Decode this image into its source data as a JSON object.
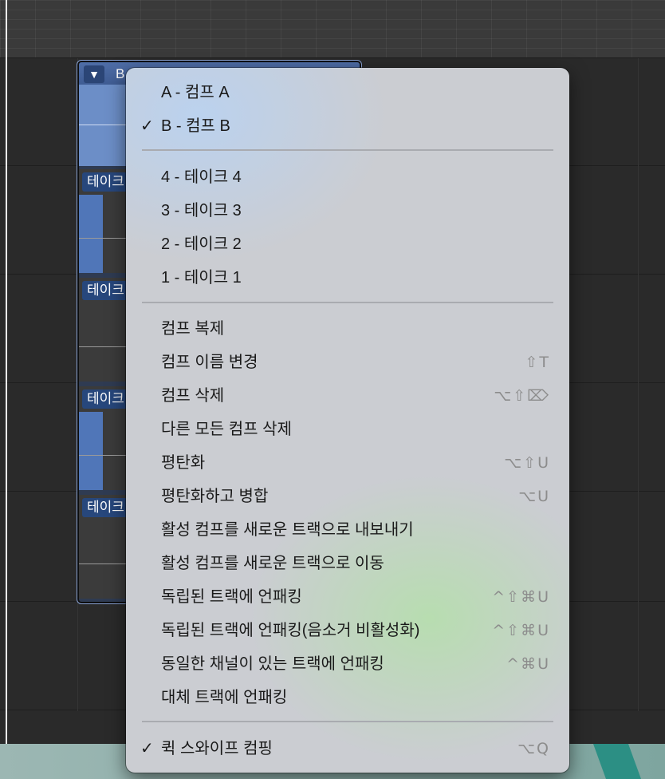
{
  "background": {
    "take_folder": {
      "disclosure_icon": "▼",
      "name": "B",
      "take_labels": [
        "테이크",
        "테이크",
        "테이크",
        "테이크"
      ]
    }
  },
  "menu": {
    "comps": [
      {
        "label": "A - 컴프 A",
        "checked": false
      },
      {
        "label": "B - 컴프 B",
        "checked": true
      }
    ],
    "takes": [
      {
        "label": "4 - 테이크 4"
      },
      {
        "label": "3 - 테이크 3"
      },
      {
        "label": "2 - 테이크 2"
      },
      {
        "label": "1 - 테이크 1"
      }
    ],
    "actions": [
      {
        "label": "컴프 복제",
        "shortcut": ""
      },
      {
        "label": "컴프 이름 변경",
        "shortcut": "⇧T"
      },
      {
        "label": "컴프 삭제",
        "shortcut": "⌥⇧⌦"
      },
      {
        "label": "다른 모든 컴프 삭제",
        "shortcut": ""
      },
      {
        "label": "평탄화",
        "shortcut": "⌥⇧U"
      },
      {
        "label": "평탄화하고 병합",
        "shortcut": "⌥U"
      },
      {
        "label": "활성 컴프를 새로운 트랙으로 내보내기",
        "shortcut": ""
      },
      {
        "label": "활성 컴프를 새로운 트랙으로 이동",
        "shortcut": ""
      },
      {
        "label": "독립된 트랙에 언패킹",
        "shortcut": "^⇧⌘U"
      },
      {
        "label": "독립된 트랙에 언패킹(음소거 비활성화)",
        "shortcut": "^⇧⌘U"
      },
      {
        "label": "동일한 채널이 있는 트랙에 언패킹",
        "shortcut": "^⌘U"
      },
      {
        "label": "대체 트랙에 언패킹",
        "shortcut": ""
      }
    ],
    "quick_swipe": {
      "label": "퀵 스와이프 컴핑",
      "checked": true,
      "shortcut": "⌥Q"
    },
    "checkmark": "✓"
  }
}
